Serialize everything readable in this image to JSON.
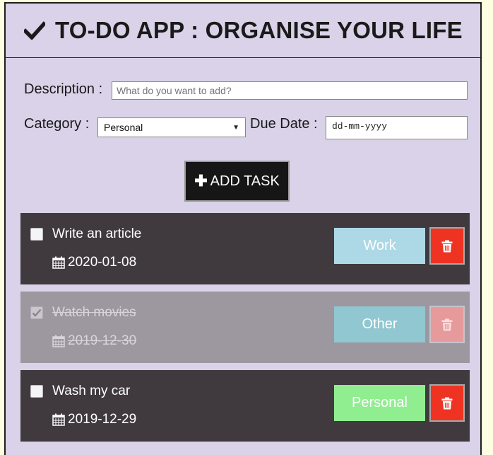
{
  "header": {
    "title": "TO-DO APP : ORGANISE YOUR LIFE"
  },
  "form": {
    "description_label": "Description :",
    "description_placeholder": "What do you want to add?",
    "category_label": "Category :",
    "category_value": "Personal",
    "due_date_label": "Due Date :",
    "due_date_placeholder": "dd-mm-yyyy",
    "add_button_label": "ADD TASK"
  },
  "tasks": [
    {
      "name": "Write an article",
      "date": "2020-01-08",
      "category": "Work",
      "completed": false,
      "category_color": "#add8e6"
    },
    {
      "name": "Watch movies",
      "date": "2019-12-30",
      "category": "Other",
      "completed": true,
      "category_color": "#90c7d0"
    },
    {
      "name": "Wash my car",
      "date": "2019-12-29",
      "category": "Personal",
      "completed": false,
      "category_color": "#90ee90"
    }
  ],
  "colors": {
    "background": "#d9d2e8",
    "task_dark": "#403a3e",
    "task_done": "#9d97a0",
    "delete": "#ee3322",
    "delete_done": "#e79a9b",
    "button": "#161616"
  }
}
